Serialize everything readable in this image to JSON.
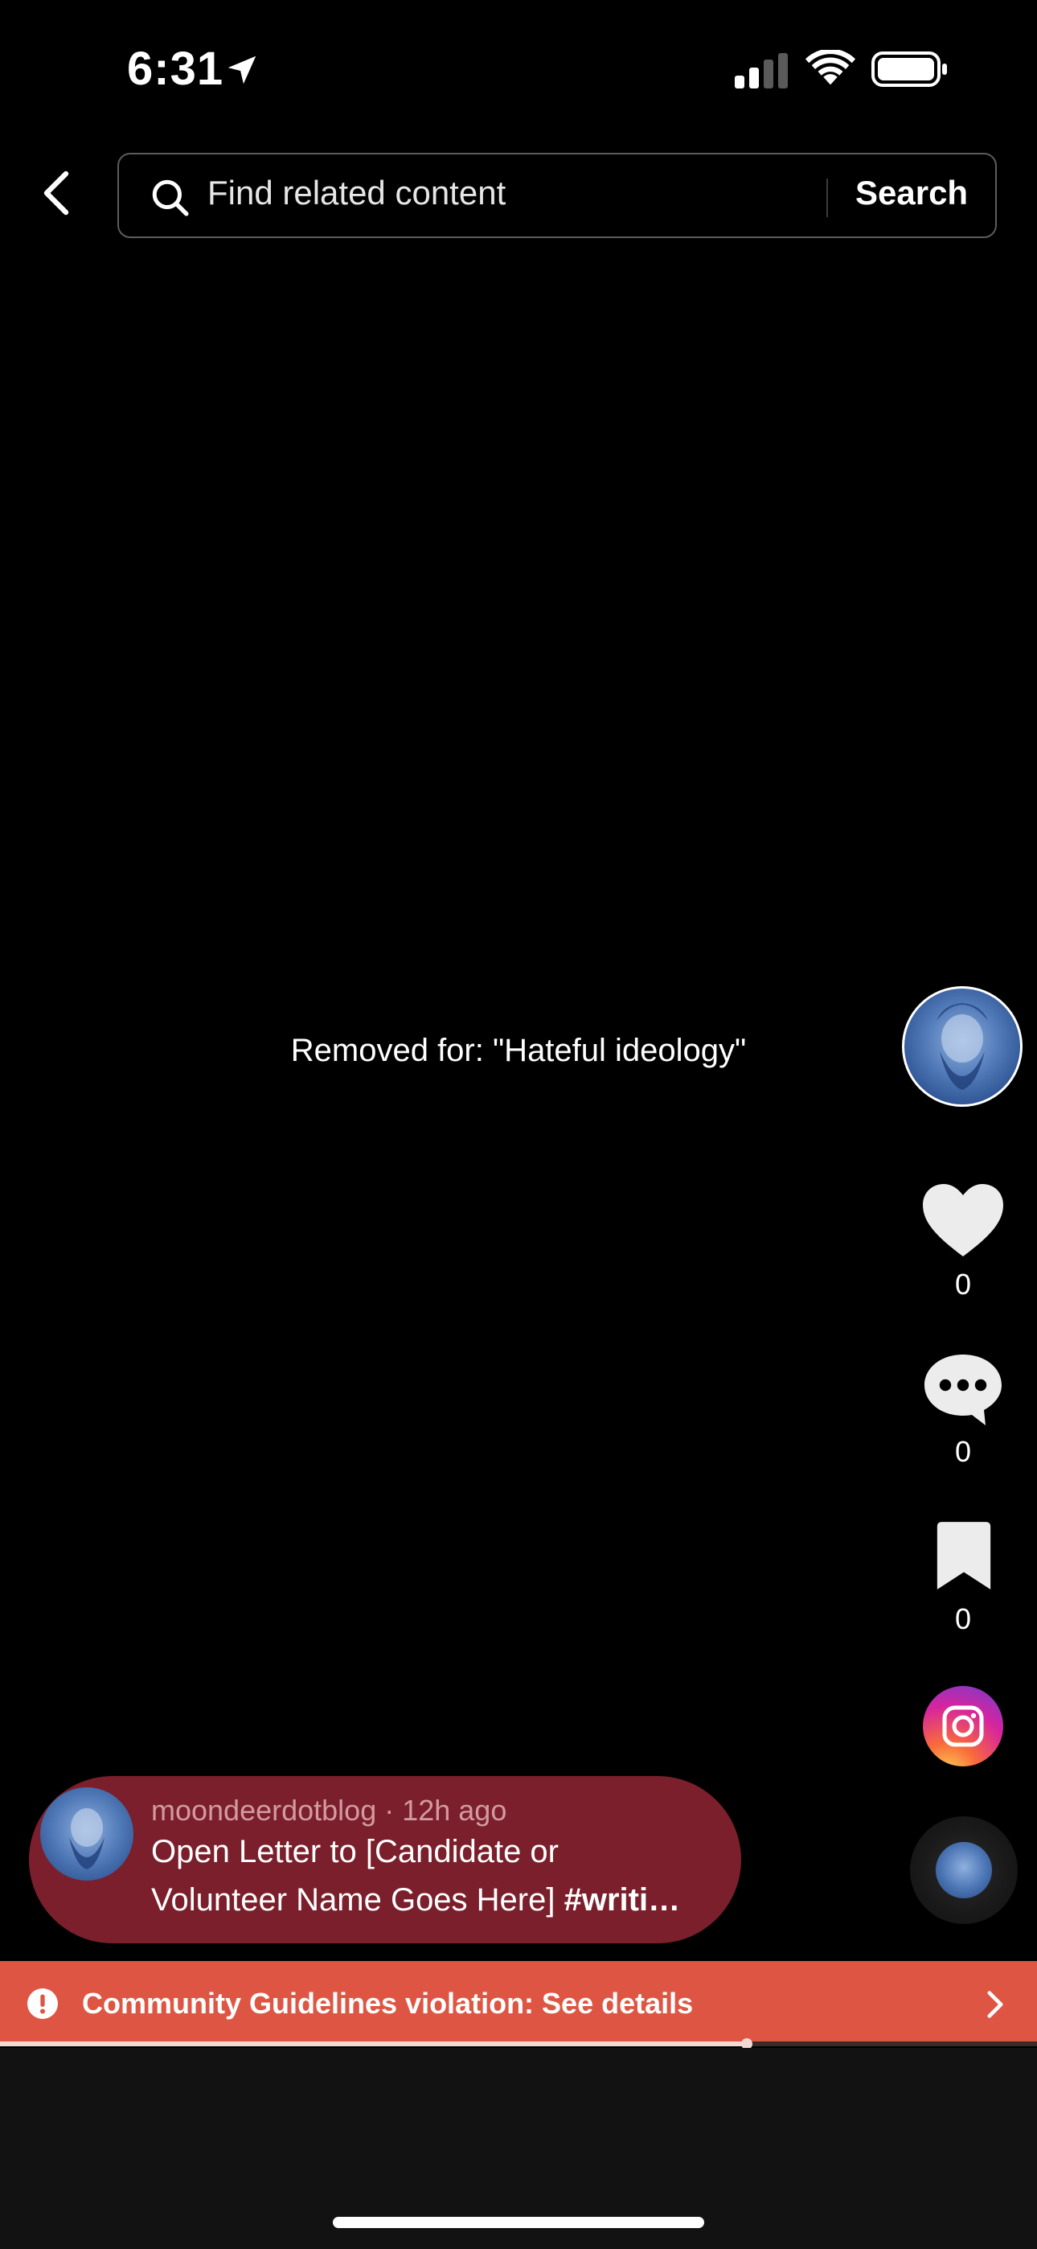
{
  "status_bar": {
    "time": "6:31",
    "icons": [
      "location-arrow-icon",
      "cellular-signal-icon",
      "wifi-icon",
      "battery-icon"
    ]
  },
  "search": {
    "placeholder": "Find related content",
    "button_label": "Search"
  },
  "video": {
    "removed_message": "Removed for: \"Hateful ideology\""
  },
  "actions": {
    "likes": "0",
    "comments": "0",
    "bookmarks": "0",
    "share_icon": "instagram-icon"
  },
  "caption": {
    "meta": "moondeerdotblog · 12h ago",
    "line1": "Open Letter to [Candidate or",
    "line2_text": "Volunteer Name Goes Here] ",
    "line2_hashtag": "#writi…"
  },
  "violation": {
    "text": "Community Guidelines violation: See details"
  },
  "playback": {
    "progress_fraction": 0.72
  },
  "colors": {
    "banner": "#de5643",
    "caption_card": "#7a1f2b",
    "background": "#000000"
  }
}
